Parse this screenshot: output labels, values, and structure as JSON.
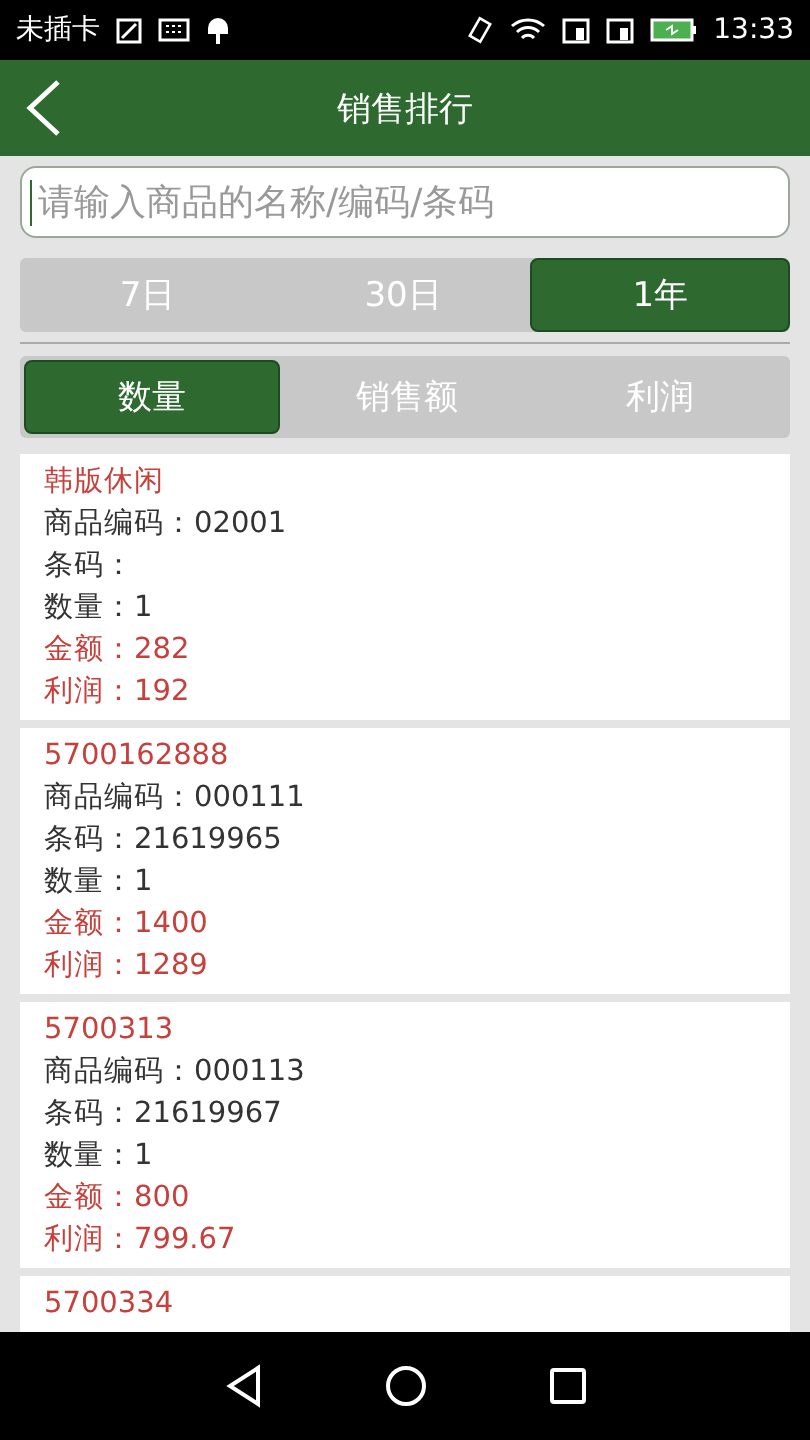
{
  "status_bar": {
    "carrier": "未插卡",
    "time": "13:33"
  },
  "header": {
    "title": "销售排行"
  },
  "search": {
    "placeholder": "请输入商品的名称/编码/条码"
  },
  "period_tabs": [
    {
      "label": "7日",
      "selected": false
    },
    {
      "label": "30日",
      "selected": false
    },
    {
      "label": "1年",
      "selected": true
    }
  ],
  "metric_tabs": [
    {
      "label": "数量",
      "selected": true
    },
    {
      "label": "销售额",
      "selected": false
    },
    {
      "label": "利润",
      "selected": false
    }
  ],
  "products": [
    {
      "name": "韩版休闲",
      "lines": [
        {
          "text": "商品编码：02001",
          "kind": "info"
        },
        {
          "text": "条码：",
          "kind": "info"
        },
        {
          "text": "数量：1",
          "kind": "info"
        },
        {
          "text": "金额：282",
          "kind": "money"
        },
        {
          "text": "利润：192",
          "kind": "money"
        }
      ]
    },
    {
      "name": "5700162888",
      "lines": [
        {
          "text": "商品编码：000111",
          "kind": "info"
        },
        {
          "text": "条码：21619965",
          "kind": "info"
        },
        {
          "text": "数量：1",
          "kind": "info"
        },
        {
          "text": "金额：1400",
          "kind": "money"
        },
        {
          "text": "利润：1289",
          "kind": "money"
        }
      ]
    },
    {
      "name": "5700313",
      "lines": [
        {
          "text": "商品编码：000113",
          "kind": "info"
        },
        {
          "text": "条码：21619967",
          "kind": "info"
        },
        {
          "text": "数量：1",
          "kind": "info"
        },
        {
          "text": "金额：800",
          "kind": "money"
        },
        {
          "text": "利润：799.67",
          "kind": "money"
        }
      ]
    },
    {
      "name": "5700334"
    }
  ]
}
